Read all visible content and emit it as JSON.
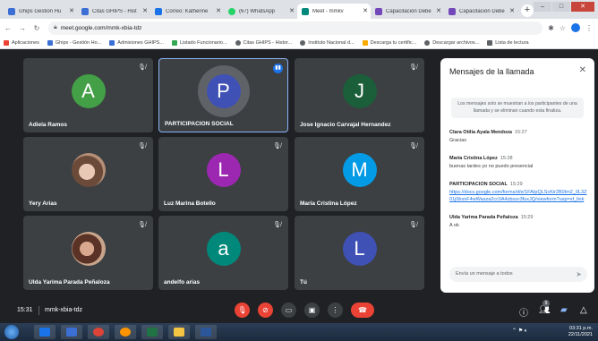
{
  "browser": {
    "tabs": [
      {
        "title": "Ghips Gestión Hu",
        "color": "#3b6fd4",
        "active": false
      },
      {
        "title": "Citas GHIPS - Hist",
        "color": "#3b6fd4",
        "active": false
      },
      {
        "title": "Correo: Katherine",
        "color": "#1a73e8",
        "active": false
      },
      {
        "title": "(67) WhatsApp",
        "color": "#25d366",
        "active": false
      },
      {
        "title": "Meet - mmkv",
        "color": "#00897b",
        "active": true
      },
      {
        "title": "Capacitación Debe",
        "color": "#7248b9",
        "active": false
      },
      {
        "title": "Capacitación Debe",
        "color": "#7248b9",
        "active": false
      }
    ],
    "url": "meet.google.com/mmk-xbia-tdz",
    "bookmarks": [
      {
        "label": "Aplicaciones",
        "color": "#ea4335"
      },
      {
        "label": "Ghips - Gestión Ho...",
        "color": "#3b6fd4"
      },
      {
        "label": "Admisiones GHIPS...",
        "color": "#3b6fd4"
      },
      {
        "label": "Listado Funcionario...",
        "color": "#34a853"
      },
      {
        "label": "Citas GHIPS - Histor...",
        "color": "#5f6368"
      },
      {
        "label": "Instituto Nacional d...",
        "color": "#5f6368"
      },
      {
        "label": "Descarga tu certific...",
        "color": "#f9ab00"
      },
      {
        "label": "Descargar archivos...",
        "color": "#5f6368"
      },
      {
        "label": "Lista de lectura",
        "color": "#5f6368"
      }
    ]
  },
  "meet": {
    "participants": [
      {
        "name": "Adiela Ramos",
        "initial": "A",
        "color": "#43a047",
        "speaking": false,
        "photo": false
      },
      {
        "name": "PARTICIPACION SOCIAL",
        "initial": "P",
        "color": "#3f51b5",
        "speaking": true,
        "photo": false
      },
      {
        "name": "Jose Ignacio Carvajal Hernandez",
        "initial": "J",
        "color": "#1b5e3a",
        "speaking": false,
        "photo": false
      },
      {
        "name": "Yery Arias",
        "initial": "",
        "color": "",
        "speaking": false,
        "photo": true
      },
      {
        "name": "Luz Marina Botello",
        "initial": "L",
        "color": "#9c27b0",
        "speaking": false,
        "photo": false
      },
      {
        "name": "María Cristina López",
        "initial": "M",
        "color": "#039be5",
        "speaking": false,
        "photo": false
      },
      {
        "name": "Ulda Yarima Parada Peñaloza",
        "initial": "",
        "color": "",
        "speaking": false,
        "photo": true
      },
      {
        "name": "andelfo arias",
        "initial": "a",
        "color": "#00897b",
        "speaking": false,
        "photo": false
      },
      {
        "name": "Tú",
        "initial": "L",
        "color": "#3f51b5",
        "speaking": false,
        "photo": false
      }
    ],
    "chat": {
      "title": "Mensajes de la llamada",
      "notice": "Los mensajes solo se muestran a los participantes de una llamada y se eliminan cuando esta finaliza.",
      "messages": [
        {
          "sender": "Clara Otilia Ayala Mendoza",
          "time": "15:27",
          "text": "Gracias",
          "link": false
        },
        {
          "sender": "María Cristina López",
          "time": "15:28",
          "text": "buenas tardes yo no puedo presencial",
          "link": false
        },
        {
          "sender": "PARTICIPACION SOCIAL",
          "time": "15:29",
          "text": "https://docs.google.com/forms/d/e/1FAIpQLScKir2B0Im2_0L3Z01j0bxnF4wWasza2cc0A4zbszv3fuxJQ/viewform?usp=sf_link",
          "link": true
        },
        {
          "sender": "Ulda Yarima Parada Peñaloza",
          "time": "15:29",
          "text": "A ok",
          "link": false
        }
      ],
      "input_placeholder": "Envía un mensaje a todos"
    },
    "controls": {
      "clock": "15:31",
      "meeting_code": "mmk-xbia-tdz",
      "people_count": "9"
    }
  },
  "taskbar": {
    "time": "03:31 p.m.",
    "date": "22/11/2021"
  },
  "colors": {
    "meet_bg": "#202124",
    "tile_bg": "#3c4043",
    "end_call": "#ea4335",
    "accent": "#1a73e8"
  }
}
